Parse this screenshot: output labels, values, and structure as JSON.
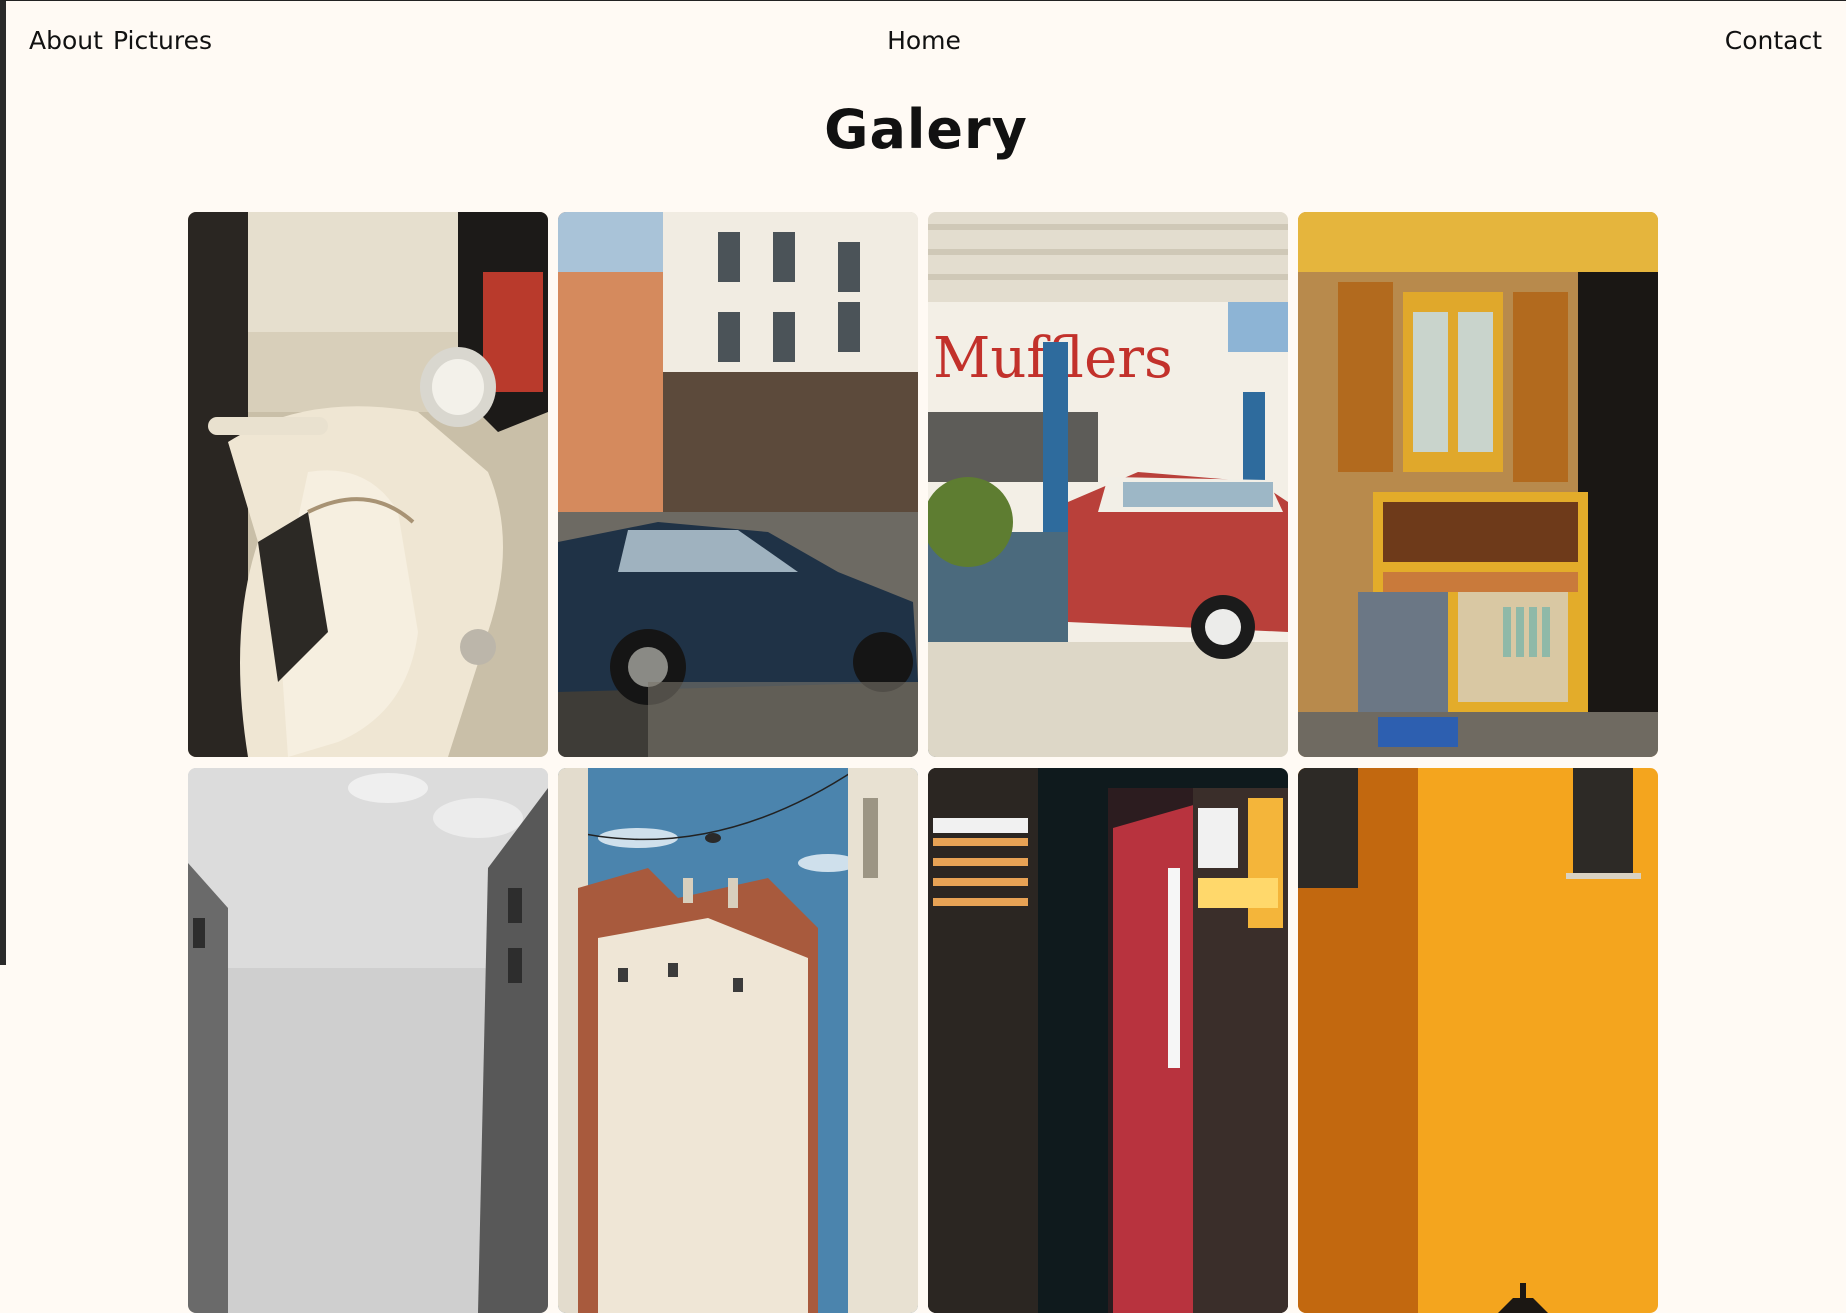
{
  "nav": {
    "about": "About",
    "pictures": "Pictures",
    "home": "Home",
    "contact": "Contact"
  },
  "page": {
    "title": "Galery"
  },
  "gallery": {
    "photos": [
      {
        "subject": "vintage scooter",
        "sign_text": ""
      },
      {
        "subject": "street with classic car",
        "sign_text": ""
      },
      {
        "subject": "classic car at Mufflers garage",
        "sign_text": "Mufflers"
      },
      {
        "subject": "shop stall with yellow shutters",
        "sign_text": ""
      },
      {
        "subject": "black and white street",
        "sign_text": ""
      },
      {
        "subject": "rooftops under blue sky",
        "sign_text": ""
      },
      {
        "subject": "city at night with neon signs",
        "sign_text": ""
      },
      {
        "subject": "orange wall with lamp",
        "sign_text": ""
      }
    ]
  },
  "colors": {
    "background": "#fffaf4",
    "text": "#111111"
  }
}
